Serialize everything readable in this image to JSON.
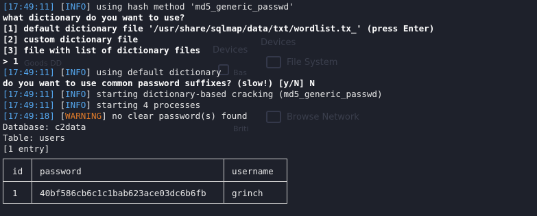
{
  "ghost": {
    "devices_label": "Devices",
    "devices_right": "Devices",
    "file_system": "File System",
    "browse_network": "Browse Network",
    "small_a": "Goods DD",
    "small_b": "Bas",
    "small_c": "Briti"
  },
  "lines": [
    {
      "ts": "17:49:11",
      "tag": "INFO",
      "text": " using hash method 'md5_generic_passwd'"
    },
    {
      "plain": "what dictionary do you want to use?",
      "bold": true
    },
    {
      "plain": "[1] default dictionary file '/usr/share/sqlmap/data/txt/wordlist.tx_' (press Enter)",
      "bold": true
    },
    {
      "plain": "[2] custom dictionary file",
      "bold": true
    },
    {
      "plain": "[3] file with list of dictionary files",
      "bold": true
    },
    {
      "plain": "> 1",
      "bold": true
    },
    {
      "ts": "17:49:11",
      "tag": "INFO",
      "text": " using default dictionary"
    },
    {
      "plain": "do you want to use common password suffixes? (slow!) [y/N] N",
      "bold": true
    },
    {
      "ts": "17:49:11",
      "tag": "INFO",
      "text": " starting dictionary-based cracking (md5_generic_passwd)"
    },
    {
      "ts": "17:49:11",
      "tag": "INFO",
      "text": " starting 4 processes"
    },
    {
      "ts": "17:49:18",
      "tag": "WARNING",
      "text": " no clear password(s) found"
    },
    {
      "plain": "Database: c2data"
    },
    {
      "plain": "Table: users"
    },
    {
      "plain": "[1 entry]"
    }
  ],
  "table": {
    "headers": {
      "id": "id",
      "password": "password",
      "username": "username"
    },
    "row": {
      "id": "1",
      "password": "40bf586cb6c1c1bab623ace03dc6b6fb",
      "username": "grinch"
    }
  },
  "colors": {
    "background": "#1e212b",
    "timestamp": "#55a8f0",
    "warning": "#e07b2a",
    "text": "#e6e6e6"
  }
}
